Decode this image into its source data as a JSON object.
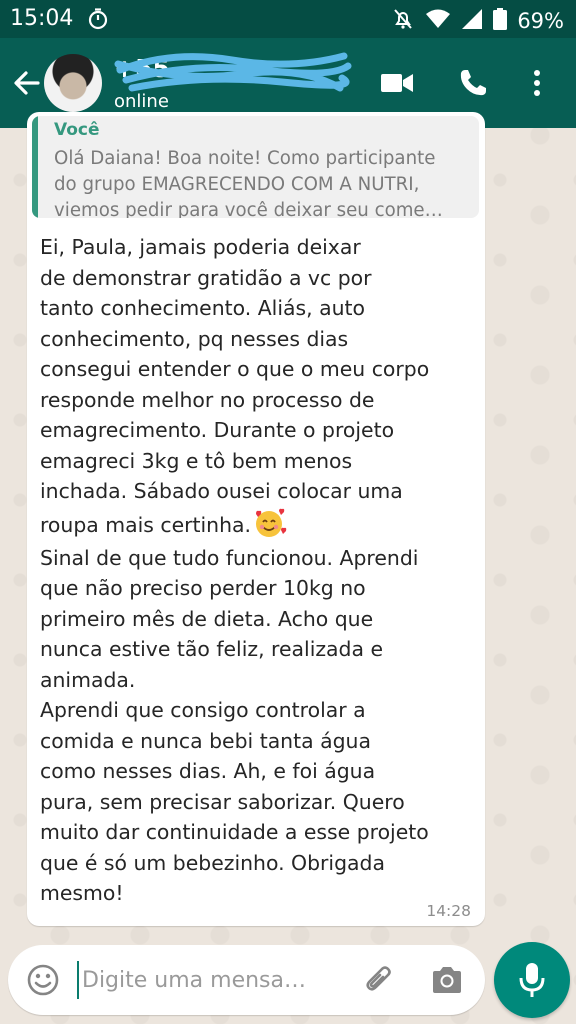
{
  "status_bar": {
    "time": "15:04",
    "battery": "69%"
  },
  "header": {
    "contact_name": "+55 ",
    "contact_status": "online"
  },
  "message": {
    "quote_author": "Você",
    "quote_lines": [
      "Olá Daiana! Boa noite! Como participante",
      "do grupo EMAGRECENDO COM A NUTRI,",
      "viemos pedir para você deixar seu come…"
    ],
    "lines": [
      "Ei, Paula, jamais poderia deixar",
      "de demonstrar gratidão a vc por",
      "tanto conhecimento. Aliás, auto",
      "conhecimento, pq nesses dias",
      "consegui entender o que o meu corpo",
      "responde melhor no processo de",
      "emagrecimento. Durante o projeto",
      "emagreci 3kg e tô bem menos",
      "inchada. Sábado ousei colocar uma",
      "roupa mais certinha.",
      "Sinal de que tudo funcionou. Aprendi",
      "que não preciso perder 10kg no",
      "primeiro mês de dieta. Acho que",
      "nunca estive tão feliz, realizada e",
      "animada.",
      "Aprendi que consigo controlar a",
      "comida e nunca bebi tanta água",
      "como nesses dias. Ah, e foi água",
      "pura, sem precisar saborizar. Quero",
      "muito dar continuidade a esse projeto",
      "que é só um bebezinho. Obrigada",
      "mesmo!"
    ],
    "emoji": "smiling-face-with-hearts",
    "time": "14:28"
  },
  "composer": {
    "placeholder": "Digite uma mensa…"
  },
  "colors": {
    "header": "#075e54",
    "status_bar": "#054d44",
    "accent": "#00897b",
    "quote_accent": "#35987f"
  }
}
